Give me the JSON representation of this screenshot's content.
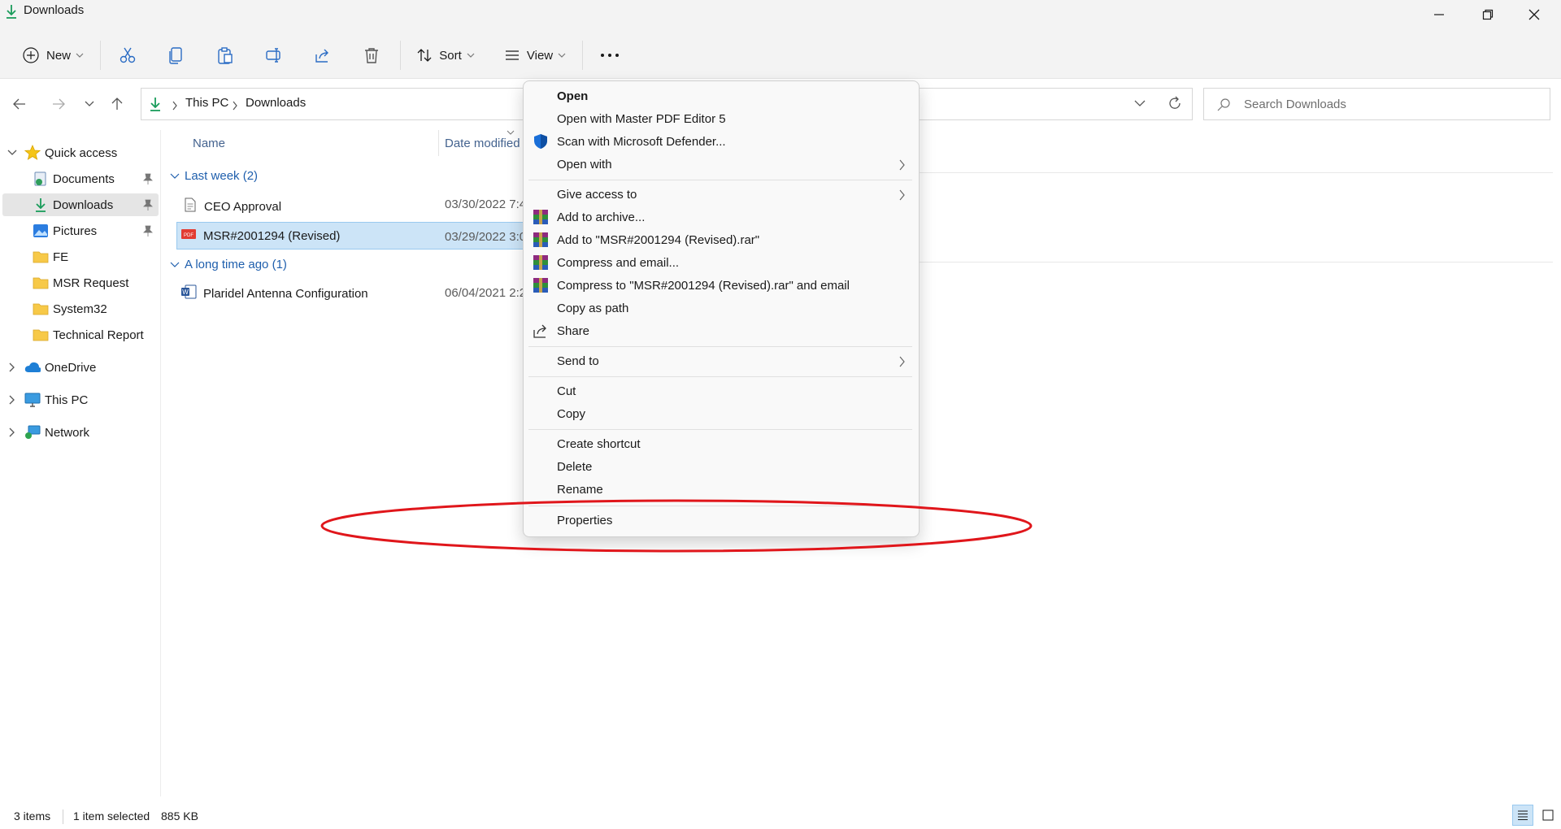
{
  "window": {
    "title": "Downloads"
  },
  "toolbar": {
    "new_label": "New",
    "sort_label": "Sort",
    "view_label": "View"
  },
  "address": {
    "crumbs": [
      "This PC",
      "Downloads"
    ]
  },
  "search": {
    "placeholder": "Search Downloads"
  },
  "sidebar": {
    "quick_access": "Quick access",
    "items": [
      "Documents",
      "Downloads",
      "Pictures",
      "FE",
      "MSR Request",
      "System32",
      "Technical Report"
    ],
    "onedrive": "OneDrive",
    "this_pc": "This PC",
    "network": "Network"
  },
  "file_list": {
    "columns": [
      "Name",
      "Date modified"
    ],
    "groups": [
      {
        "label": "Last week (2)",
        "files": [
          {
            "name": "CEO Approval",
            "date": "03/30/2022 7:4"
          },
          {
            "name": "MSR#2001294 (Revised)",
            "date": "03/29/2022 3:0"
          }
        ]
      },
      {
        "label": "A long time ago (1)",
        "files": [
          {
            "name": "Plaridel Antenna Configuration",
            "date": "06/04/2021 2:2"
          }
        ]
      }
    ]
  },
  "context_menu": {
    "items": [
      "Open",
      "Open with Master PDF Editor 5",
      "Scan with Microsoft Defender...",
      "Open with",
      "Give access to",
      "Add to archive...",
      "Add to \"MSR#2001294 (Revised).rar\"",
      "Compress and email...",
      "Compress to \"MSR#2001294 (Revised).rar\" and email",
      "Copy as path",
      "Share",
      "Send to",
      "Cut",
      "Copy",
      "Create shortcut",
      "Delete",
      "Rename",
      "Properties"
    ]
  },
  "status": {
    "item_count": "3 items",
    "selection": "1 item selected",
    "size": "885 KB"
  },
  "colors": {
    "accent": "#0f7b0f",
    "selection": "#cce4f7",
    "annotation": "#e0161b"
  }
}
